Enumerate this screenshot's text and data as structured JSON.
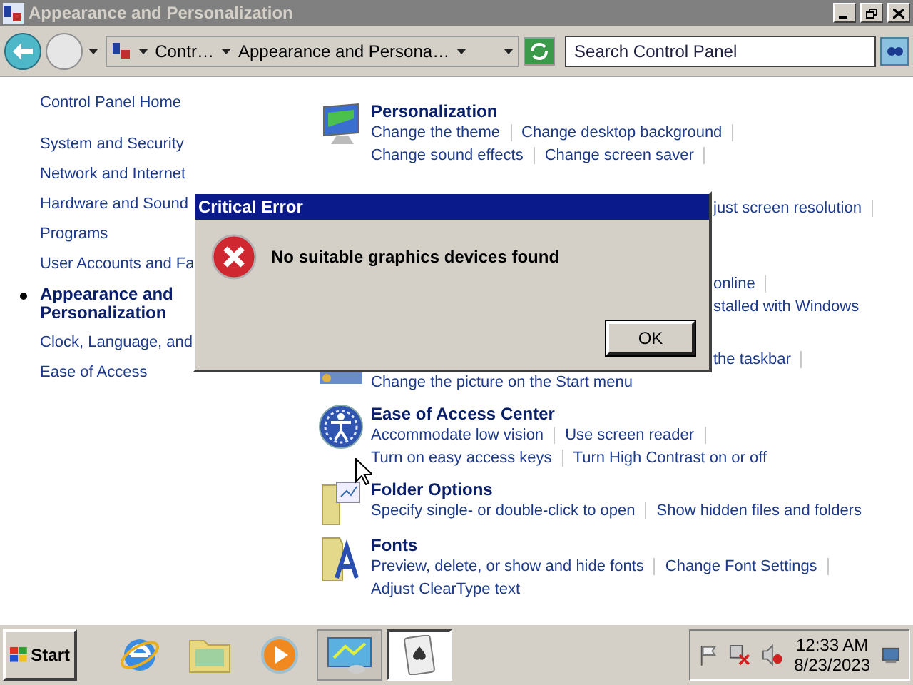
{
  "window": {
    "title": "Appearance and Personalization"
  },
  "address": {
    "segments": [
      "Contr…",
      "Appearance and Persona…"
    ]
  },
  "search": {
    "placeholder": "Search Control Panel"
  },
  "nav": {
    "items": [
      {
        "label": "Control Panel Home",
        "selected": false
      },
      {
        "label": "System and Security",
        "selected": false
      },
      {
        "label": "Network and Internet",
        "selected": false
      },
      {
        "label": "Hardware and Sound",
        "selected": false
      },
      {
        "label": "Programs",
        "selected": false
      },
      {
        "label": "User Accounts and Fa",
        "selected": false
      },
      {
        "label": "Appearance and Personalization",
        "selected": true
      },
      {
        "label": "Clock, Language, and",
        "selected": false
      },
      {
        "label": "Ease of Access",
        "selected": false
      }
    ]
  },
  "sections": [
    {
      "kind": "full",
      "heading": "Personalization",
      "rows": [
        {
          "links": [
            "Change the theme",
            "Change desktop background"
          ]
        },
        {
          "links": [
            "Change sound effects",
            "Change screen saver"
          ]
        }
      ]
    },
    {
      "kind": "covered-deep",
      "rows": [
        {
          "links": [
            "just screen resolution"
          ],
          "cut": true
        }
      ]
    },
    {
      "kind": "covered",
      "rows": [
        {
          "links": [
            "online"
          ],
          "cut": true
        },
        {
          "links": [
            "stalled with Windows"
          ],
          "cut": true,
          "end": true
        }
      ]
    },
    {
      "kind": "covered",
      "rows": [
        {
          "links": [
            "the taskbar"
          ],
          "cut": true
        },
        {
          "links": [
            "Change the picture on the Start menu"
          ],
          "cut": false,
          "end": true
        }
      ]
    },
    {
      "kind": "full",
      "heading": "Ease of Access Center",
      "rows": [
        {
          "links": [
            "Accommodate low vision",
            "Use screen reader"
          ]
        },
        {
          "links": [
            "Turn on easy access keys",
            "Turn High Contrast on or off"
          ],
          "end": true
        }
      ]
    },
    {
      "kind": "full",
      "heading": "Folder Options",
      "rows": [
        {
          "links": [
            "Specify single- or double-click to open",
            "Show hidden files and folders"
          ],
          "end": true
        }
      ]
    },
    {
      "kind": "full",
      "heading": "Fonts",
      "rows": [
        {
          "links": [
            "Preview, delete, or show and hide fonts",
            "Change Font Settings"
          ]
        },
        {
          "links": [
            "Adjust ClearType text"
          ],
          "end": true
        }
      ]
    }
  ],
  "dialog": {
    "title": "Critical Error",
    "message": "No suitable graphics devices found",
    "button": "OK"
  },
  "taskbar": {
    "start": "Start",
    "apps": [
      {
        "kind": "browser",
        "selected": false
      },
      {
        "kind": "folder",
        "selected": false
      },
      {
        "kind": "media",
        "selected": false
      },
      {
        "kind": "control",
        "selected": false
      },
      {
        "kind": "cards",
        "selected": true
      }
    ],
    "time": "12:33 AM",
    "date": "8/23/2023"
  }
}
